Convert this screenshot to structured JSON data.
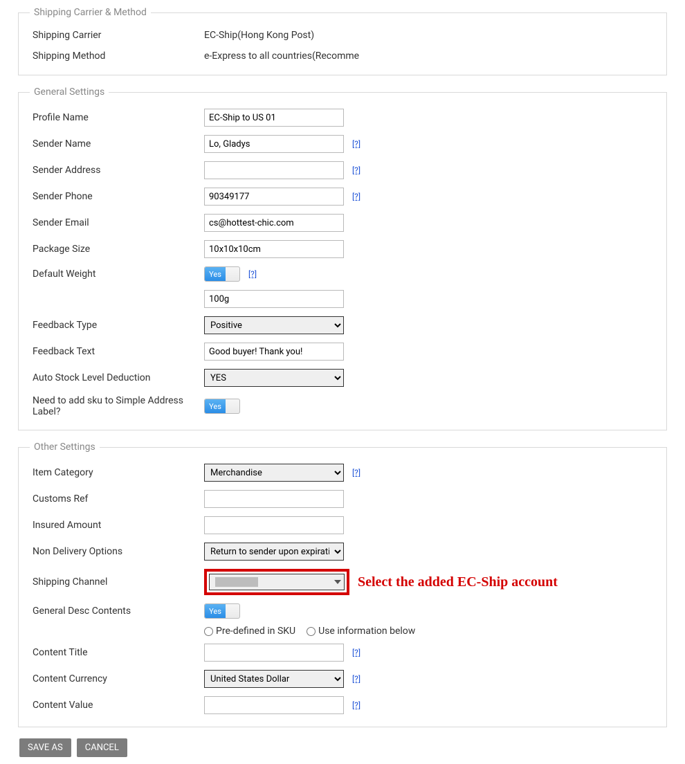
{
  "sections": {
    "shipping": {
      "legend": "Shipping Carrier & Method",
      "carrier_label": "Shipping Carrier",
      "carrier_value": "EC-Ship(Hong Kong Post)",
      "method_label": "Shipping Method",
      "method_value": "e-Express to all countries(Recomme"
    },
    "general": {
      "legend": "General Settings",
      "profile_name_label": "Profile Name",
      "profile_name_value": "EC-Ship to US 01",
      "sender_name_label": "Sender Name",
      "sender_name_value": "Lo, Gladys",
      "sender_address_label": "Sender Address",
      "sender_address_value": "",
      "sender_phone_label": "Sender Phone",
      "sender_phone_value": "90349177",
      "sender_email_label": "Sender Email",
      "sender_email_value": "cs@hottest-chic.com",
      "package_size_label": "Package Size",
      "package_size_value": "10x10x10cm",
      "default_weight_label": "Default Weight",
      "default_weight_toggle": "Yes",
      "default_weight_value": "100g",
      "feedback_type_label": "Feedback Type",
      "feedback_type_value": "Positive",
      "feedback_text_label": "Feedback Text",
      "feedback_text_value": "Good buyer! Thank you!",
      "auto_stock_label": "Auto Stock Level Deduction",
      "auto_stock_value": "YES",
      "need_sku_label": "Need to add sku to Simple Address Label?",
      "need_sku_toggle": "Yes"
    },
    "other": {
      "legend": "Other Settings",
      "item_category_label": "Item Category",
      "item_category_value": "Merchandise",
      "customs_ref_label": "Customs Ref",
      "customs_ref_value": "",
      "insured_amount_label": "Insured Amount",
      "insured_amount_value": "",
      "non_delivery_label": "Non Delivery Options",
      "non_delivery_value": "Return to sender upon expiratio",
      "shipping_channel_label": "Shipping Channel",
      "general_desc_label": "General Desc Contents",
      "general_desc_toggle": "Yes",
      "radio_predefined": "Pre-defined in SKU",
      "radio_below": "Use information below",
      "content_title_label": "Content Title",
      "content_title_value": "",
      "content_currency_label": "Content Currency",
      "content_currency_value": "United States Dollar",
      "content_value_label": "Content Value",
      "content_value_value": ""
    }
  },
  "help": "[?]",
  "annotation": "Select the added EC-Ship account",
  "buttons": {
    "save_as": "SAVE AS",
    "cancel": "CANCEL"
  }
}
